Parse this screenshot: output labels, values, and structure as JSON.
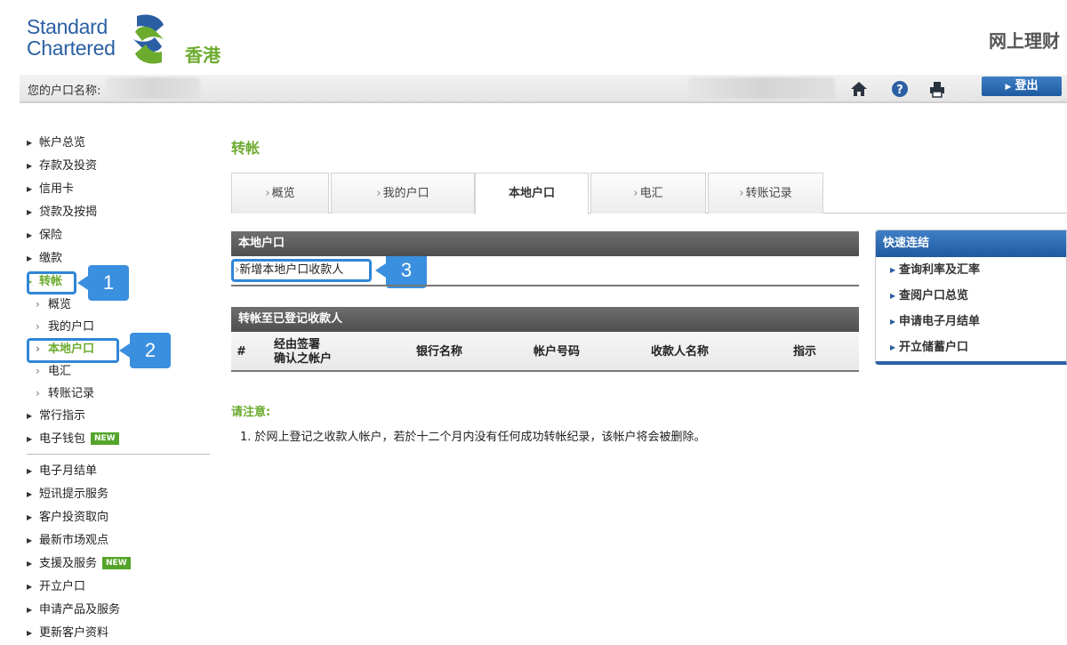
{
  "brand": {
    "line1": "Standard",
    "line2": "Chartered",
    "region": "香港",
    "site_title": "网上理财",
    "colors": {
      "blue": "#2b5fa3",
      "green": "#6cab2e"
    }
  },
  "topbar": {
    "account_label": "您的户口名称:",
    "logout_label": "登出",
    "icons": [
      "home-icon",
      "help-icon",
      "print-icon"
    ]
  },
  "sidebar": {
    "items_top": [
      "帐户总览",
      "存款及投资",
      "信用卡",
      "贷款及按揭",
      "保险",
      "缴款"
    ],
    "active": "转帐",
    "sub_items": [
      "概览",
      "我的户口",
      "本地户口",
      "电汇",
      "转账记录"
    ],
    "after_sub": [
      "常行指示"
    ],
    "wallet": "电子钱包",
    "new_badge": "NEW",
    "items_bottom": [
      "电子月结单",
      "短讯提示服务",
      "客户投资取向",
      "最新市场观点"
    ],
    "support": "支援及服务",
    "items_last": [
      "开立户口",
      "申请产品及服务",
      "更新客户资料"
    ]
  },
  "callouts": [
    "1",
    "2",
    "3"
  ],
  "main": {
    "title": "转帐",
    "tabs": [
      "概览",
      "我的户口",
      "本地户口",
      "电汇",
      "转账记录"
    ],
    "panel1_title": "本地户口",
    "add_payee_link": "新增本地户口收款人",
    "panel2_title": "转帐至已登记收款人",
    "columns": [
      "#",
      "经由签署\n确认之帐户",
      "银行名称",
      "帐户号码",
      "收款人名称",
      "指示"
    ],
    "note_title": "请注意:",
    "note_text": "1.  於网上登记之收款人帐户，若於十二个月内没有任何成功转帐纪录，该帐户将会被删除。"
  },
  "quick_links": {
    "title": "快速连结",
    "items": [
      "查询利率及汇率",
      "查阅户口总览",
      "申请电子月结单",
      "开立储蓄户口"
    ]
  }
}
